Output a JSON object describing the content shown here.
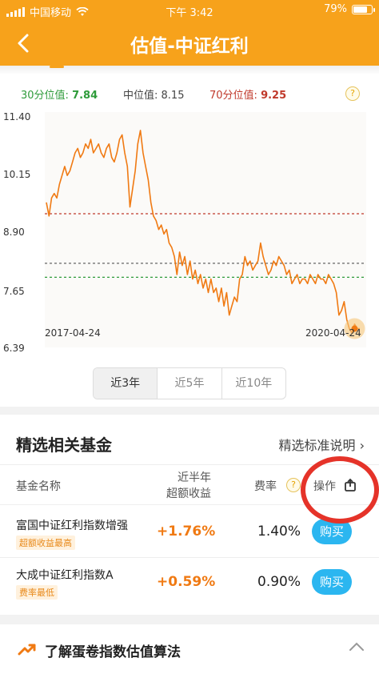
{
  "status": {
    "carrier": "中国移动",
    "time": "下午 3:42",
    "battery": "79%"
  },
  "nav": {
    "title": "估值-中证红利"
  },
  "legend": {
    "p30_label": "30分位值: ",
    "p30_value": "7.84",
    "median_label": "中位值: ",
    "median_value": "8.15",
    "p70_label": "70分位值: ",
    "p70_value": "9.25",
    "help": "?"
  },
  "chart_data": {
    "type": "line",
    "ylim": [
      6.39,
      11.4
    ],
    "yticks": [
      "11.40",
      "10.15",
      "8.90",
      "7.65",
      "6.39"
    ],
    "x_start_label": "2017-04-24",
    "x_end_label": "2020-04-24",
    "reference_lines": [
      {
        "name": "70分位值",
        "value": 9.25,
        "color": "#c0392b"
      },
      {
        "name": "中位值",
        "value": 8.15,
        "color": "#555555"
      },
      {
        "name": "30分位值",
        "value": 7.84,
        "color": "#2e9b3a"
      }
    ],
    "series_color": "#f07a13",
    "values": [
      9.5,
      9.2,
      9.6,
      9.7,
      9.6,
      9.9,
      10.1,
      10.3,
      10.1,
      10.2,
      10.4,
      10.6,
      10.7,
      10.5,
      10.6,
      10.8,
      10.7,
      10.9,
      10.6,
      10.7,
      10.8,
      10.6,
      10.5,
      10.7,
      10.8,
      10.5,
      10.4,
      10.6,
      10.9,
      11.0,
      10.6,
      10.3,
      9.4,
      9.8,
      10.2,
      10.8,
      11.1,
      10.6,
      10.3,
      10.0,
      9.5,
      9.2,
      9.1,
      8.9,
      9.0,
      8.8,
      8.9,
      8.6,
      8.5,
      8.3,
      7.9,
      8.4,
      8.1,
      8.3,
      7.9,
      8.2,
      7.8,
      8.0,
      7.7,
      7.9,
      7.6,
      7.8,
      7.5,
      7.8,
      7.5,
      7.6,
      7.3,
      7.6,
      7.2,
      7.5,
      7.0,
      7.2,
      7.4,
      7.3,
      7.8,
      7.9,
      8.3,
      8.1,
      8.2,
      8.0,
      8.1,
      8.2,
      8.6,
      8.3,
      8.1,
      7.9,
      8.0,
      8.2,
      8.1,
      8.3,
      8.2,
      8.1,
      7.9,
      8.0,
      7.7,
      7.8,
      7.9,
      7.7,
      7.8,
      7.8,
      7.7,
      7.9,
      7.8,
      7.7,
      7.9,
      7.8,
      7.8,
      7.7,
      7.9,
      7.8,
      7.7,
      7.5,
      7.0,
      7.1,
      7.3,
      6.9,
      6.7,
      6.6,
      6.8,
      6.7,
      6.7
    ]
  },
  "range_tabs": [
    "近3年",
    "近5年",
    "近10年"
  ],
  "funds": {
    "section_title": "精选相关基金",
    "criteria_link": "精选标准说明 ›",
    "col_name": "基金名称",
    "col_gain_line1": "近半年",
    "col_gain_line2": "超额收益",
    "col_fee": "费率",
    "col_fee_help": "?",
    "col_action": "操作",
    "rows": [
      {
        "name": "富国中证红利指数增强",
        "tag": "超额收益最高",
        "gain": "+1.76%",
        "fee": "1.40%",
        "buy": "购买"
      },
      {
        "name": "大成中证红利指数A",
        "tag": "费率最低",
        "gain": "+0.59%",
        "fee": "0.90%",
        "buy": "购买"
      }
    ]
  },
  "footer": {
    "learn_label": "了解蛋卷指数估值算法"
  }
}
